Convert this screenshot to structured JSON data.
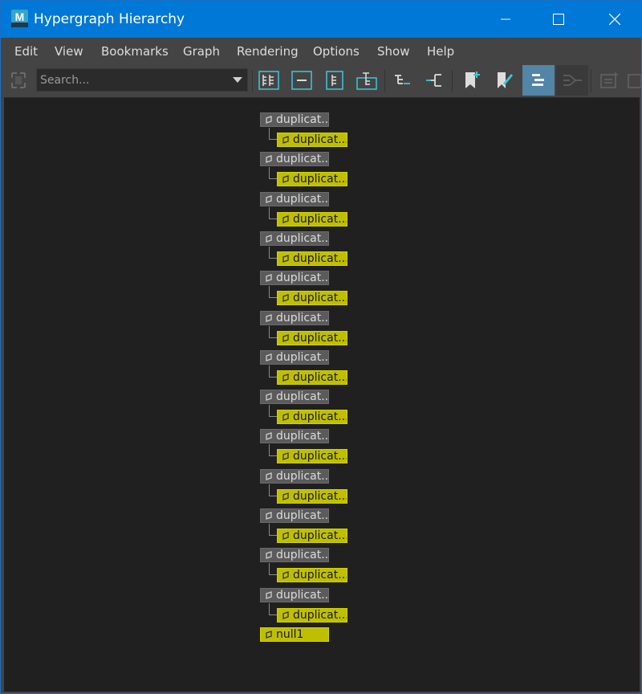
{
  "window": {
    "title": "Hypergraph Hierarchy",
    "app_icon_letter": "M",
    "accent_color": "#0078d7"
  },
  "menu": {
    "items": [
      "Edit",
      "View",
      "Bookmarks",
      "Graph",
      "Rendering",
      "Options",
      "Show",
      "Help"
    ]
  },
  "toolbar": {
    "search_placeholder": "Search...",
    "buttons": [
      "frame-all-icon",
      "frame-selection-icon",
      "frame-hierarchy-icon",
      "frame-branch-icon",
      "graph-up-downstream-icon",
      "graph-upstream-icon",
      "add-bookmark-icon",
      "edit-bookmark-icon",
      "scene-hierarchy-icon",
      "input-output-connections-icon",
      "add-node-icon"
    ],
    "active_button": "scene-hierarchy-icon"
  },
  "graph": {
    "pairs": [
      {
        "parent": "duplicat...",
        "child": "duplicat..."
      },
      {
        "parent": "duplicat...",
        "child": "duplicat..."
      },
      {
        "parent": "duplicat...",
        "child": "duplicat..."
      },
      {
        "parent": "duplicat...",
        "child": "duplicat..."
      },
      {
        "parent": "duplicat...",
        "child": "duplicat..."
      },
      {
        "parent": "duplicat...",
        "child": "duplicat..."
      },
      {
        "parent": "duplicat...",
        "child": "duplicat..."
      },
      {
        "parent": "duplicat...",
        "child": "duplicat..."
      },
      {
        "parent": "duplicat...",
        "child": "duplicat..."
      },
      {
        "parent": "duplicat...",
        "child": "duplicat..."
      },
      {
        "parent": "duplicat...",
        "child": "duplicat..."
      },
      {
        "parent": "duplicat...",
        "child": "duplicat..."
      },
      {
        "parent": "duplicat...",
        "child": "duplicat..."
      }
    ],
    "root": "null1",
    "node_colors": {
      "parent": "#5b5b5b",
      "selected": "#bfbf00"
    }
  }
}
